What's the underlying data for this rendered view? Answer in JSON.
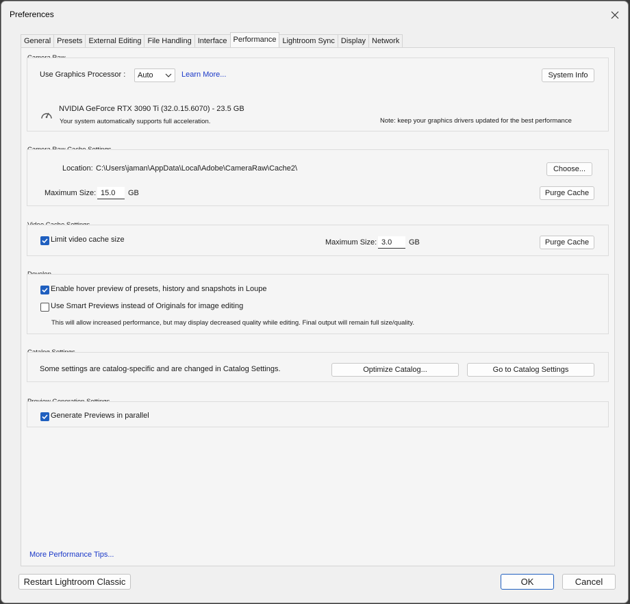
{
  "window": {
    "title": "Preferences"
  },
  "tabs": [
    "General",
    "Presets",
    "External Editing",
    "File Handling",
    "Interface",
    "Performance",
    "Lightroom Sync",
    "Display",
    "Network"
  ],
  "active_tab": "Performance",
  "camera_raw": {
    "legend": "Camera Raw",
    "gpu_label": "Use Graphics Processor :",
    "gpu_value": "Auto",
    "learn_more": "Learn More...",
    "system_info": "System Info",
    "gpu_name": "NVIDIA GeForce RTX 3090 Ti (32.0.15.6070) - 23.5 GB",
    "gpu_status": "Your system automatically supports full acceleration.",
    "note": "Note: keep your graphics drivers updated for the best performance"
  },
  "cache": {
    "legend": "Camera Raw Cache Settings",
    "location_label": "Location:",
    "location_value": "C:\\Users\\jaman\\AppData\\Local\\Adobe\\CameraRaw\\Cache2\\",
    "choose": "Choose...",
    "max_label": "Maximum Size:",
    "max_value": "15.0",
    "unit": "GB",
    "purge": "Purge Cache"
  },
  "video": {
    "legend": "Video Cache Settings",
    "limit_label": "Limit video cache size",
    "limit_checked": true,
    "max_label": "Maximum Size:",
    "max_value": "3.0",
    "unit": "GB",
    "purge": "Purge Cache"
  },
  "develop": {
    "legend": "Develop",
    "hover_label": "Enable hover preview of presets, history and snapshots in Loupe",
    "hover_checked": true,
    "smart_label": "Use Smart Previews instead of Originals for image editing",
    "smart_checked": false,
    "smart_note": "This will allow increased performance, but may display decreased quality while editing. Final output will remain full size/quality."
  },
  "catalog": {
    "legend": "Catalog Settings",
    "text": "Some settings are catalog-specific and are changed in Catalog Settings.",
    "optimize": "Optimize Catalog...",
    "goto": "Go to Catalog Settings"
  },
  "preview": {
    "legend": "Preview Generation Settings",
    "parallel_label": "Generate Previews in parallel",
    "parallel_checked": true
  },
  "more_tips": "More Performance Tips...",
  "buttons": {
    "restart": "Restart Lightroom Classic",
    "ok": "OK",
    "cancel": "Cancel"
  },
  "colors": {
    "accent": "#1f5fbf",
    "link": "#1a38c8"
  }
}
